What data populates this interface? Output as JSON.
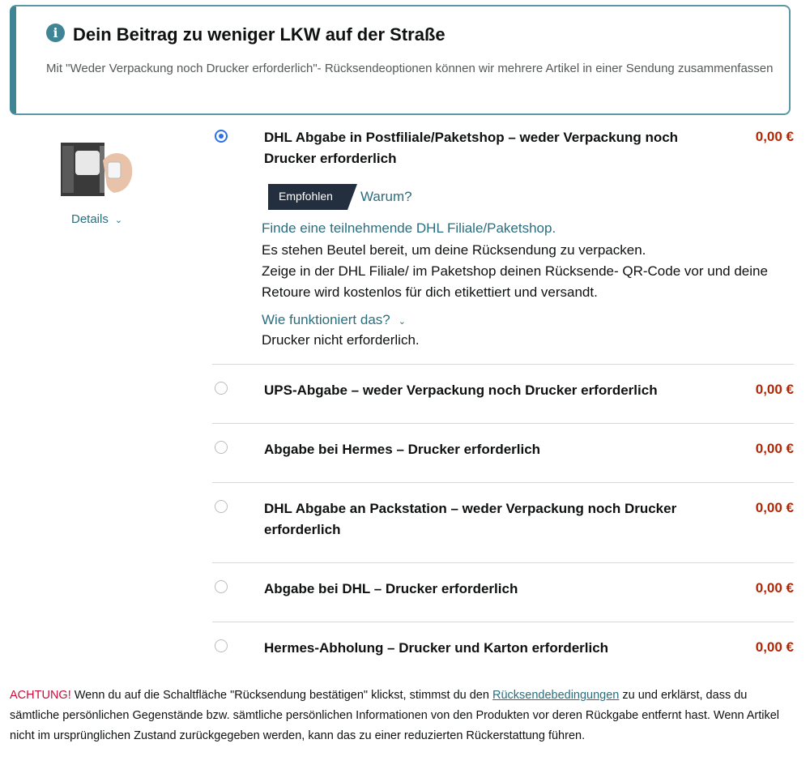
{
  "banner": {
    "icon": "info-icon",
    "title": "Dein Beitrag zu weniger LKW auf der Straße",
    "text": "Mit \"Weder Verpackung noch Drucker erforderlich\"- Rücksendeoptionen können wir mehrere Artikel in einer Sendung zusammenfassen"
  },
  "item": {
    "details_label": "Details"
  },
  "options": [
    {
      "title": "DHL Abgabe in Postfiliale/Paketshop – weder Verpackung noch Drucker erforderlich",
      "price": "0,00 €",
      "selected": true
    },
    {
      "title": "UPS-Abgabe – weder Verpackung noch Drucker erforderlich",
      "price": "0,00 €",
      "selected": false
    },
    {
      "title": "Abgabe bei Hermes – Drucker erforderlich",
      "price": "0,00 €",
      "selected": false
    },
    {
      "title": "DHL Abgabe an Packstation – weder Verpackung noch Drucker erforderlich",
      "price": "0,00 €",
      "selected": false
    },
    {
      "title": "Abgabe bei DHL – Drucker erforderlich",
      "price": "0,00 €",
      "selected": false
    },
    {
      "title": "Hermes-Abholung – Drucker und Karton erforderlich",
      "price": "0,00 €",
      "selected": false
    }
  ],
  "selected_detail": {
    "badge": "Empfohlen",
    "why_link": "Warum?",
    "find_link": "Finde eine teilnehmende DHL Filiale/Paketshop.",
    "line1": "Es stehen Beutel bereit, um deine Rücksendung zu verpacken.",
    "line2": "Zeige in der DHL Filiale/ im Paketshop deinen Rücksende- QR-Code vor und deine Retoure wird kostenlos für dich etikettiert und versandt.",
    "how_link": "Wie funktioniert das?",
    "no_printer": "Drucker nicht erforderlich."
  },
  "warning": {
    "label": "ACHTUNG!",
    "text_before": " Wenn du auf die Schaltfläche \"Rücksendung bestätigen\" klickst, stimmst du den ",
    "link": "Rücksendebedingungen",
    "text_after": " zu und erklärst, dass du sämtliche persönlichen Gegenstände bzw. sämtliche persönlichen Informationen von den Produkten vor deren Rückgabe entfernt hast. Wenn Artikel nicht im ursprünglichen Zustand zurückgegeben werden, kann das zu einer reduzierten Rückerstattung führen."
  },
  "colors": {
    "accent_teal": "#3f8595",
    "link": "#2a6e7e",
    "price": "#b12704",
    "radio_selected": "#2c6fe6",
    "warning": "#cc0c39",
    "badge_bg": "#232f3e"
  }
}
